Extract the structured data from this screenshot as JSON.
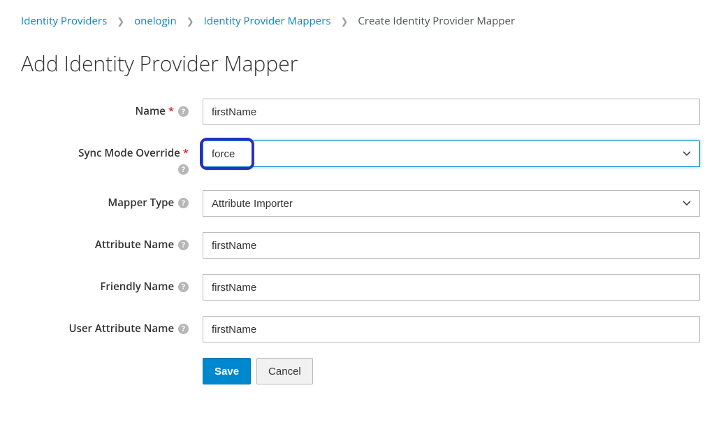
{
  "breadcrumb": {
    "items": [
      {
        "label": "Identity Providers",
        "link": true
      },
      {
        "label": "onelogin",
        "link": true
      },
      {
        "label": "Identity Provider Mappers",
        "link": true
      },
      {
        "label": "Create Identity Provider Mapper",
        "link": false
      }
    ]
  },
  "page": {
    "title": "Add Identity Provider Mapper"
  },
  "form": {
    "name": {
      "label": "Name",
      "value": "firstName",
      "required": true
    },
    "sync_mode": {
      "label": "Sync Mode Override",
      "value": "force",
      "required": true
    },
    "mapper_type": {
      "label": "Mapper Type",
      "value": "Attribute Importer",
      "required": false
    },
    "attribute_name": {
      "label": "Attribute Name",
      "value": "firstName",
      "required": false
    },
    "friendly_name": {
      "label": "Friendly Name",
      "value": "firstName",
      "required": false
    },
    "user_attribute_name": {
      "label": "User Attribute Name",
      "value": "firstName",
      "required": false
    },
    "buttons": {
      "save": "Save",
      "cancel": "Cancel"
    }
  }
}
